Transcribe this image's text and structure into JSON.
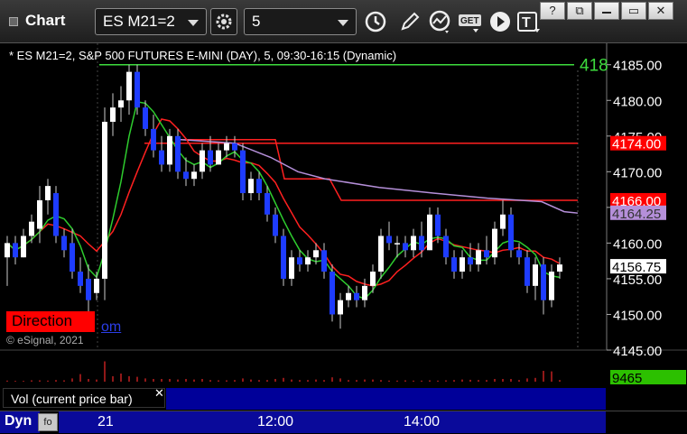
{
  "window": {
    "title": "Chart",
    "symbol": "ES M21=2",
    "interval": "5",
    "buttons": [
      "?",
      "⧉",
      "▭",
      "✕"
    ]
  },
  "toolbar_icons": [
    "clock-icon",
    "pencil-icon",
    "indicator-icon",
    "get-icon",
    "play-icon",
    "text-icon"
  ],
  "chart": {
    "label": "* ES M21=2, S&P 500 FUTURES E-MINI (DAY), 5, 09:30-16:15 (Dynamic)",
    "direction_label": "Direction",
    "copyright": "© eSignal, 2021",
    "link_fragment": "om",
    "price_ticks": [
      "4185.00",
      "4180.00",
      "4175.00",
      "4170.00",
      "4165.00",
      "4160.00",
      "4155.00",
      "4150.00",
      "4145.00"
    ],
    "price_badges": [
      {
        "label": "4174.00",
        "value": 4174.0,
        "bg": "#ff0000",
        "fg": "#ffffff"
      },
      {
        "label": "4166.00",
        "value": 4166.0,
        "bg": "#ff0000",
        "fg": "#ffffff"
      },
      {
        "label": "4164.25",
        "value": 4164.25,
        "bg": "#b58fd9",
        "fg": "#333333"
      },
      {
        "label": "4156.75",
        "value": 4156.75,
        "bg": "#ffffff",
        "fg": "#000000"
      }
    ],
    "green_level_text": "418",
    "green_level_value": 4185.0,
    "red_level_1": 4174.0,
    "red_level_2": 4166.0
  },
  "volume": {
    "label": "Vol (current price bar)",
    "close": "✕",
    "badge": "9465",
    "badge_bg": "#2cc000"
  },
  "xaxis": {
    "dyn_label": "Dyn",
    "dyn_icon": "fo",
    "ticks": [
      {
        "label": "21",
        "bar": 12
      },
      {
        "label": "12:00",
        "bar": 33
      },
      {
        "label": "14:00",
        "bar": 51
      }
    ]
  },
  "chart_data": {
    "type": "bar",
    "title": "* ES M21=2, S&P 500 FUTURES E-MINI (DAY), 5, 09:30-16:15 (Dynamic)",
    "ylim": [
      4145,
      4188
    ],
    "candles": [
      {
        "o": 4158,
        "h": 4161,
        "l": 4154,
        "c": 4160
      },
      {
        "o": 4160,
        "h": 4161,
        "l": 4157,
        "c": 4158
      },
      {
        "o": 4158,
        "h": 4162,
        "l": 4158,
        "c": 4161
      },
      {
        "o": 4161,
        "h": 4164,
        "l": 4160,
        "c": 4163
      },
      {
        "o": 4162,
        "h": 4168,
        "l": 4160,
        "c": 4166
      },
      {
        "o": 4166,
        "h": 4169,
        "l": 4164,
        "c": 4168
      },
      {
        "o": 4167,
        "h": 4168,
        "l": 4160,
        "c": 4161
      },
      {
        "o": 4161,
        "h": 4162,
        "l": 4158,
        "c": 4159
      },
      {
        "o": 4160,
        "h": 4162,
        "l": 4155,
        "c": 4156
      },
      {
        "o": 4156,
        "h": 4158,
        "l": 4153,
        "c": 4154
      },
      {
        "o": 4155,
        "h": 4157,
        "l": 4150,
        "c": 4152
      },
      {
        "o": 4153,
        "h": 4156,
        "l": 4152,
        "c": 4155
      },
      {
        "o": 4155,
        "h": 4179,
        "l": 4152,
        "c": 4177
      },
      {
        "o": 4177,
        "h": 4181,
        "l": 4175,
        "c": 4179
      },
      {
        "o": 4179,
        "h": 4182,
        "l": 4177,
        "c": 4180
      },
      {
        "o": 4180,
        "h": 4185,
        "l": 4178,
        "c": 4184
      },
      {
        "o": 4184,
        "h": 4185,
        "l": 4178,
        "c": 4179
      },
      {
        "o": 4179,
        "h": 4180,
        "l": 4175,
        "c": 4176
      },
      {
        "o": 4176,
        "h": 4178,
        "l": 4172,
        "c": 4173
      },
      {
        "o": 4173,
        "h": 4175,
        "l": 4170,
        "c": 4171
      },
      {
        "o": 4171,
        "h": 4176,
        "l": 4170,
        "c": 4175
      },
      {
        "o": 4175,
        "h": 4176,
        "l": 4169,
        "c": 4170
      },
      {
        "o": 4170,
        "h": 4172,
        "l": 4168,
        "c": 4169
      },
      {
        "o": 4169,
        "h": 4171,
        "l": 4168,
        "c": 4170
      },
      {
        "o": 4170,
        "h": 4174,
        "l": 4169,
        "c": 4173
      },
      {
        "o": 4173,
        "h": 4175,
        "l": 4170,
        "c": 4171
      },
      {
        "o": 4171,
        "h": 4174,
        "l": 4171,
        "c": 4173
      },
      {
        "o": 4173,
        "h": 4175,
        "l": 4172,
        "c": 4174
      },
      {
        "o": 4174,
        "h": 4175,
        "l": 4172,
        "c": 4173
      },
      {
        "o": 4173,
        "h": 4174,
        "l": 4166,
        "c": 4167
      },
      {
        "o": 4167,
        "h": 4170,
        "l": 4166,
        "c": 4169
      },
      {
        "o": 4169,
        "h": 4170,
        "l": 4166,
        "c": 4167
      },
      {
        "o": 4167,
        "h": 4168,
        "l": 4163,
        "c": 4164
      },
      {
        "o": 4164,
        "h": 4165,
        "l": 4160,
        "c": 4161
      },
      {
        "o": 4161,
        "h": 4162,
        "l": 4154,
        "c": 4155
      },
      {
        "o": 4155,
        "h": 4159,
        "l": 4154,
        "c": 4158
      },
      {
        "o": 4158,
        "h": 4159,
        "l": 4156,
        "c": 4157
      },
      {
        "o": 4157,
        "h": 4159,
        "l": 4156,
        "c": 4158
      },
      {
        "o": 4158,
        "h": 4160,
        "l": 4157,
        "c": 4159
      },
      {
        "o": 4159,
        "h": 4160,
        "l": 4155,
        "c": 4156
      },
      {
        "o": 4156,
        "h": 4157,
        "l": 4149,
        "c": 4150
      },
      {
        "o": 4150,
        "h": 4153,
        "l": 4148,
        "c": 4152
      },
      {
        "o": 4152,
        "h": 4154,
        "l": 4151,
        "c": 4153
      },
      {
        "o": 4153,
        "h": 4154,
        "l": 4151,
        "c": 4152
      },
      {
        "o": 4152,
        "h": 4155,
        "l": 4151,
        "c": 4154
      },
      {
        "o": 4154,
        "h": 4157,
        "l": 4153,
        "c": 4156
      },
      {
        "o": 4156,
        "h": 4162,
        "l": 4155,
        "c": 4161
      },
      {
        "o": 4161,
        "h": 4163,
        "l": 4159,
        "c": 4160
      },
      {
        "o": 4160,
        "h": 4161,
        "l": 4158,
        "c": 4160
      },
      {
        "o": 4160,
        "h": 4161,
        "l": 4158,
        "c": 4159
      },
      {
        "o": 4159,
        "h": 4162,
        "l": 4158,
        "c": 4161
      },
      {
        "o": 4161,
        "h": 4163,
        "l": 4158,
        "c": 4159
      },
      {
        "o": 4159,
        "h": 4165,
        "l": 4159,
        "c": 4164
      },
      {
        "o": 4164,
        "h": 4165,
        "l": 4160,
        "c": 4161
      },
      {
        "o": 4161,
        "h": 4162,
        "l": 4157,
        "c": 4158
      },
      {
        "o": 4158,
        "h": 4159,
        "l": 4155,
        "c": 4156
      },
      {
        "o": 4156,
        "h": 4159,
        "l": 4155,
        "c": 4158
      },
      {
        "o": 4158,
        "h": 4160,
        "l": 4156,
        "c": 4157
      },
      {
        "o": 4157,
        "h": 4160,
        "l": 4156,
        "c": 4159
      },
      {
        "o": 4159,
        "h": 4161,
        "l": 4157,
        "c": 4158
      },
      {
        "o": 4158,
        "h": 4163,
        "l": 4157,
        "c": 4162
      },
      {
        "o": 4162,
        "h": 4166,
        "l": 4161,
        "c": 4164
      },
      {
        "o": 4164,
        "h": 4165,
        "l": 4158,
        "c": 4159
      },
      {
        "o": 4159,
        "h": 4160,
        "l": 4157,
        "c": 4158
      },
      {
        "o": 4158,
        "h": 4159,
        "l": 4153,
        "c": 4154
      },
      {
        "o": 4154,
        "h": 4158,
        "l": 4152,
        "c": 4157
      },
      {
        "o": 4157,
        "h": 4158,
        "l": 4150,
        "c": 4152
      },
      {
        "o": 4152,
        "h": 4157,
        "l": 4151,
        "c": 4156
      },
      {
        "o": 4156,
        "h": 4158,
        "l": 4155,
        "c": 4157
      }
    ],
    "volumes": [
      0.04,
      0.03,
      0.03,
      0.05,
      0.05,
      0.04,
      0.06,
      0.05,
      0.12,
      0.28,
      0.1,
      0.08,
      0.75,
      0.2,
      0.3,
      0.2,
      0.18,
      0.12,
      0.1,
      0.1,
      0.1,
      0.08,
      0.1,
      0.08,
      0.1,
      0.06,
      0.05,
      0.05,
      0.06,
      0.12,
      0.08,
      0.06,
      0.06,
      0.1,
      0.14,
      0.08,
      0.06,
      0.06,
      0.08,
      0.06,
      0.16,
      0.12,
      0.06,
      0.06,
      0.08,
      0.08,
      0.06,
      0.04,
      0.04,
      0.05,
      0.04,
      0.04,
      0.05,
      0.04,
      0.05,
      0.06,
      0.08,
      0.07,
      0.06,
      0.06,
      0.1,
      0.1,
      0.1,
      0.06,
      0.12,
      0.14,
      0.4,
      0.38,
      0.06
    ]
  }
}
